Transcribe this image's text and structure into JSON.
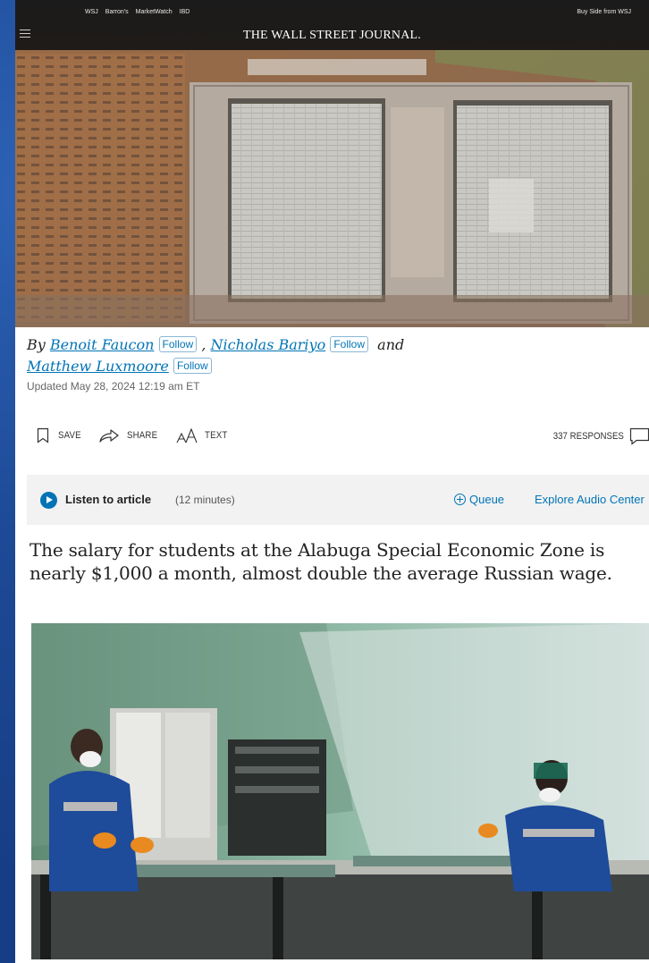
{
  "header": {
    "network_links": [
      "WSJ",
      "Barron's",
      "MarketWatch",
      "IBD"
    ],
    "buy_side": "Buy Side from WSJ",
    "masthead": "THE WALL STREET JOURNAL."
  },
  "byline": {
    "prefix": "By",
    "authors": [
      "Benoit Faucon",
      "Nicholas Bariyo",
      "Matthew Luxmoore"
    ],
    "follow_label": "Follow",
    "separator": ",",
    "and": "and",
    "updated": "Updated May 28, 2024 12:19 am ET"
  },
  "tools": {
    "save": "SAVE",
    "share": "SHARE",
    "text": "TEXT",
    "responses": "337 RESPONSES"
  },
  "listen": {
    "label": "Listen to article",
    "duration": "(12 minutes)",
    "queue": "Queue",
    "explore": "Explore Audio Center"
  },
  "article": {
    "caption": "The salary for students at the Alabuga Special Economic Zone is nearly $1,000 a month, almost double the average Russian wage."
  },
  "colors": {
    "link": "#0274b6",
    "frame": "#1f4f9c"
  },
  "icons": [
    "menu-icon",
    "bookmark-icon",
    "share-icon",
    "text-size-icon",
    "comment-icon",
    "play-icon",
    "plus-circle-icon"
  ]
}
